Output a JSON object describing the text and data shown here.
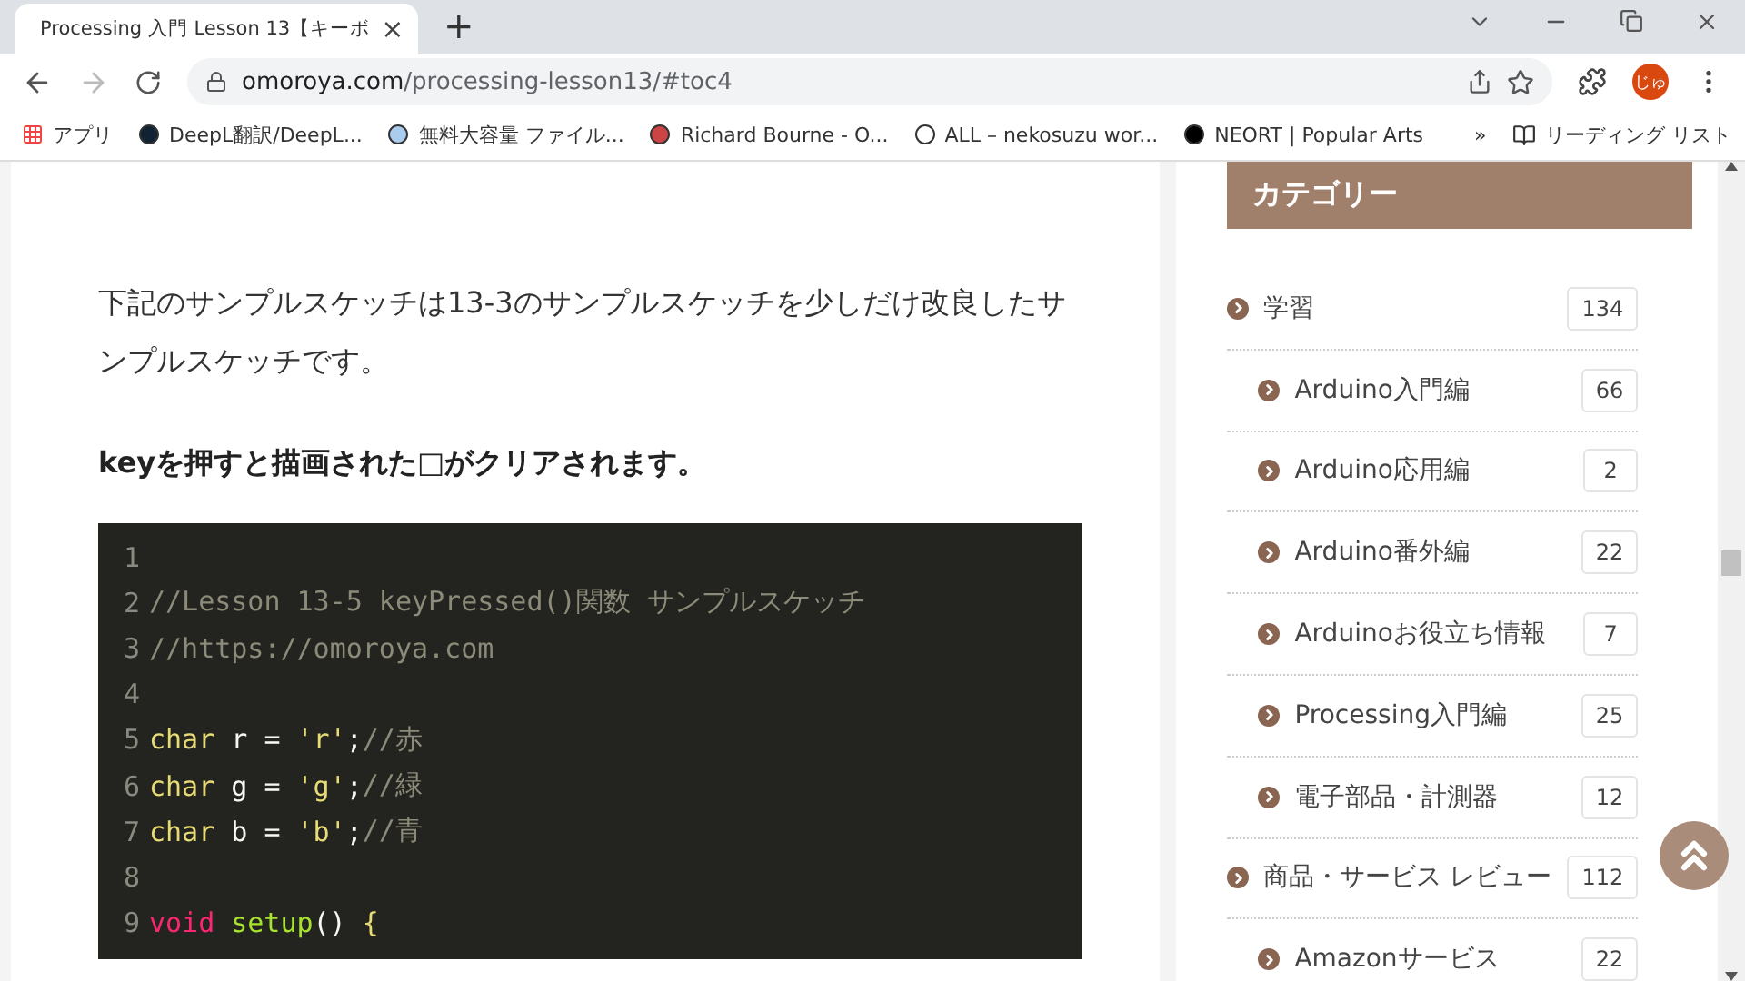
{
  "browser": {
    "tab": {
      "title": "Processing 入門 Lesson 13【キーボ",
      "close": "×"
    },
    "new_tab": "+",
    "url": {
      "domain": "omoroya.com",
      "path": "/processing-lesson13/#toc4"
    },
    "profile": "じゅ",
    "bookmarks": [
      {
        "label": "アプリ"
      },
      {
        "label": "DeepL翻訳/DeepL..."
      },
      {
        "label": "無料大容量 ファイル..."
      },
      {
        "label": "Richard Bourne - O..."
      },
      {
        "label": "ALL – nekosuzu wor..."
      },
      {
        "label": "NEORT | Popular Arts"
      }
    ],
    "more": "»",
    "reading_list": "リーディング リスト"
  },
  "article": {
    "paragraph": "下記のサンプルスケッチは13-3のサンプルスケッチを少しだけ改良したサンプルスケッチです。",
    "heading": "keyを押すと描画された□がクリアされます。",
    "code": [
      {
        "number": "1"
      },
      {
        "number": "2",
        "tokens": [
          {
            "kind": "comment",
            "text": "//Lesson 13-5 keyPressed()関数 サンプルスケッチ"
          }
        ]
      },
      {
        "number": "3",
        "tokens": [
          {
            "kind": "comment",
            "text": "//https://omoroya.com"
          }
        ]
      },
      {
        "number": "4"
      },
      {
        "number": "5",
        "tokens": [
          {
            "kind": "type",
            "text": "char"
          },
          {
            "kind": "plain",
            "text": " r = "
          },
          {
            "kind": "string",
            "text": "'r'"
          },
          {
            "kind": "plain",
            "text": ";"
          },
          {
            "kind": "comment",
            "text": "//赤"
          }
        ]
      },
      {
        "number": "6",
        "tokens": [
          {
            "kind": "type",
            "text": "char"
          },
          {
            "kind": "plain",
            "text": " g = "
          },
          {
            "kind": "string",
            "text": "'g'"
          },
          {
            "kind": "plain",
            "text": ";"
          },
          {
            "kind": "comment",
            "text": "//緑"
          }
        ]
      },
      {
        "number": "7",
        "tokens": [
          {
            "kind": "type",
            "text": "char"
          },
          {
            "kind": "plain",
            "text": " b = "
          },
          {
            "kind": "string",
            "text": "'b'"
          },
          {
            "kind": "plain",
            "text": ";"
          },
          {
            "kind": "comment",
            "text": "//青"
          }
        ]
      },
      {
        "number": "8"
      },
      {
        "number": "9",
        "tokens": [
          {
            "kind": "keyword",
            "text": "void"
          },
          {
            "kind": "function",
            "text": "setup"
          },
          {
            "kind": "plain",
            "text": "() "
          },
          {
            "kind": "string",
            "text": "{"
          }
        ]
      }
    ]
  },
  "sidebar": {
    "title": "カテゴリー",
    "categories": [
      {
        "label": "学習",
        "count": "134",
        "children": [
          {
            "label": "Arduino入門編",
            "count": "66"
          },
          {
            "label": "Arduino応用編",
            "count": "2"
          },
          {
            "label": "Arduino番外編",
            "count": "22"
          },
          {
            "label": "Arduinoお役立ち情報",
            "count": "7"
          },
          {
            "label": "Processing入門編",
            "count": "25"
          },
          {
            "label": "電子部品・計測器",
            "count": "12"
          }
        ]
      },
      {
        "label": "商品・サービス レビュー",
        "count": "112",
        "children": [
          {
            "label": "Amazonサービス",
            "count": "22"
          }
        ]
      }
    ]
  }
}
